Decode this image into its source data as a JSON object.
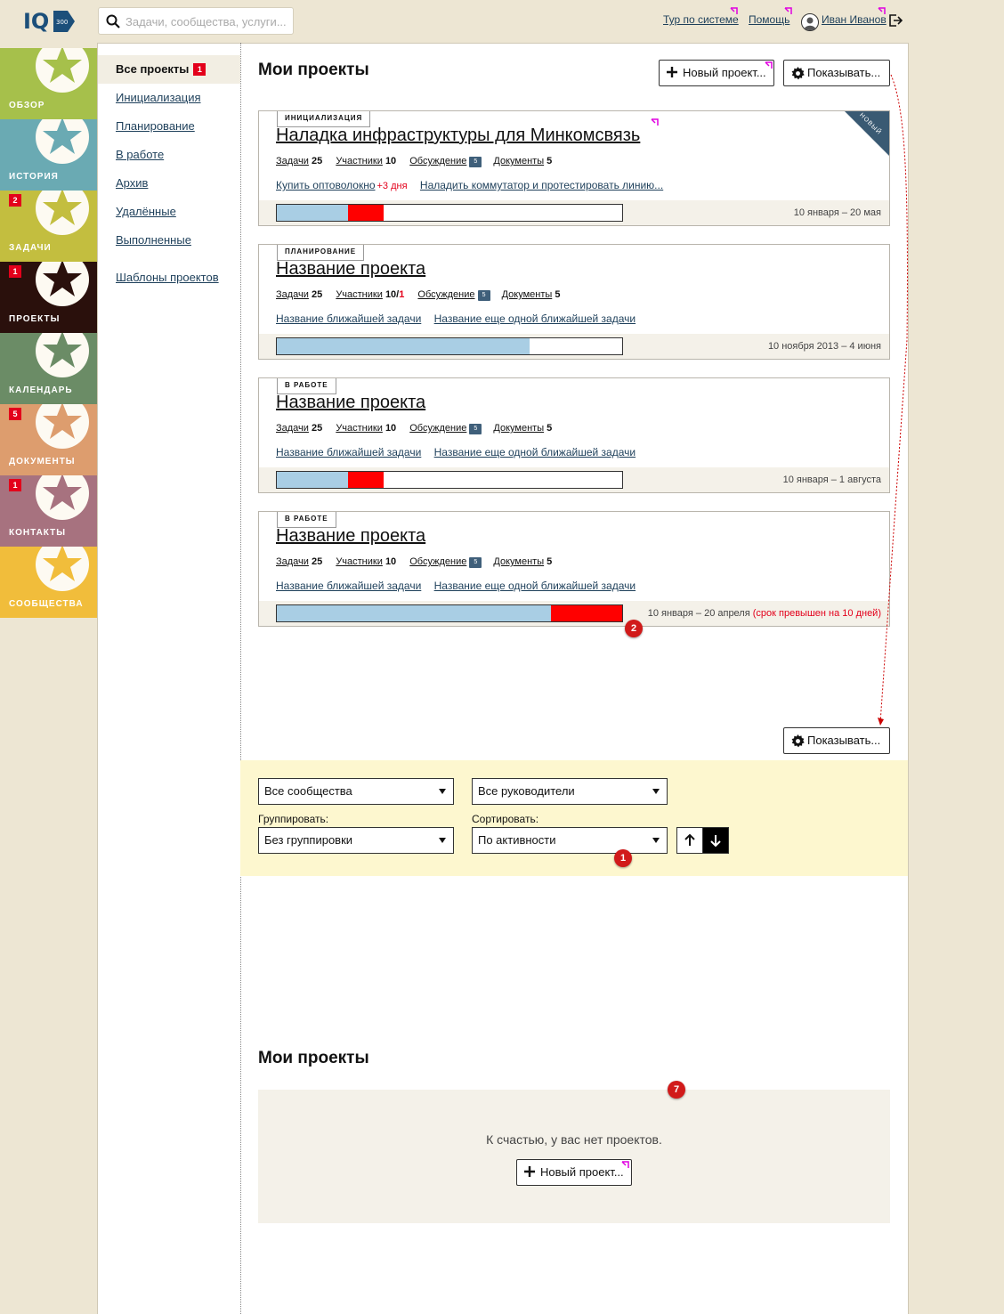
{
  "header": {
    "logo_text": "IQ",
    "logo_sub": "300",
    "search_placeholder": "Задачи, сообщества, услуги...",
    "tour": "Тур по системе",
    "help": "Помощь",
    "user": "Иван Иванов"
  },
  "nav": [
    {
      "label": "ОБЗОР",
      "color": "#a6c04b",
      "star": "#a6c04b",
      "badge": ""
    },
    {
      "label": "ИСТОРИЯ",
      "color": "#6aaab3",
      "star": "#6aaab3",
      "badge": ""
    },
    {
      "label": "ЗАДАЧИ",
      "color": "#c3be3f",
      "star": "#c3be3f",
      "badge": "2"
    },
    {
      "label": "ПРОЕКТЫ",
      "color": "#2a100c",
      "star": "#2a100c",
      "badge": "1"
    },
    {
      "label": "КАЛЕНДАРЬ",
      "color": "#6b8c66",
      "star": "#6b8c66",
      "badge": ""
    },
    {
      "label": "ДОКУМЕНТЫ",
      "color": "#dd9d6e",
      "star": "#dd9d6e",
      "badge": "5"
    },
    {
      "label": "КОНТАКТЫ",
      "color": "#a7727f",
      "star": "#a7727f",
      "badge": "1"
    },
    {
      "label": "СООБЩЕСТВА",
      "color": "#f1bd3b",
      "star": "#f1bd3b",
      "badge": ""
    }
  ],
  "subnav": {
    "all": "Все проекты",
    "all_badge": "1",
    "init": "Инициализация",
    "plan": "Планирование",
    "work": "В работе",
    "archive": "Архив",
    "deleted": "Удалённые",
    "completed": "Выполненные",
    "templates": "Шаблоны проектов"
  },
  "main": {
    "title": "Мои проекты",
    "new_project": "Новый проект...",
    "show": "Показывать..."
  },
  "labels": {
    "tasks": "Задачи",
    "members": "Участники",
    "discussion": "Обсуждение",
    "docs": "Документы",
    "new_corner": "НОВЫЙ"
  },
  "projects": [
    {
      "status": "ИНИЦИАЛИЗАЦИЯ",
      "title": "Наладка инфраструктуры для Минкомсвязь",
      "tasks": "25",
      "members": "10",
      "members_extra": "",
      "discussion": "5",
      "docs": "5",
      "task1": "Купить оптоволокно",
      "task1_late": "+3 дня",
      "task2": "Наладить коммутатор и протестировать линию...",
      "progress_done": 0.205,
      "progress_over": 0.103,
      "dates": "10 января – 20 мая",
      "dates_warn": "",
      "is_new": true
    },
    {
      "status": "ПЛАНИРОВАНИЕ",
      "title": "Название проекта",
      "tasks": "25",
      "members": "10/",
      "members_extra": "1",
      "discussion": "5",
      "docs": "5",
      "task1": "Название ближайшей задачи",
      "task1_late": "",
      "task2": "Название еще одной ближайшей задачи",
      "progress_done": 0.733,
      "progress_over": 0,
      "dates": "10 ноября 2013 – 4 июня",
      "dates_warn": "",
      "is_new": false
    },
    {
      "status": "В РАБОТЕ",
      "title": "Название проекта",
      "tasks": "25",
      "members": "10",
      "members_extra": "",
      "discussion": "5",
      "docs": "5",
      "task1": "Название ближайшей задачи",
      "task1_late": "",
      "task2": "Название еще одной ближайшей задачи",
      "progress_done": 0.205,
      "progress_over": 0.103,
      "dates": "10 января – 1 августа",
      "dates_warn": "",
      "is_new": false
    },
    {
      "status": "В РАБОТЕ",
      "title": "Название проекта",
      "tasks": "25",
      "members": "10",
      "members_extra": "",
      "discussion": "5",
      "docs": "5",
      "task1": "Название ближайшей задачи",
      "task1_late": "",
      "task2": "Название еще одной ближайшей задачи",
      "progress_done": 0.795,
      "progress_over": 0.205,
      "dates": "10 января – 20 апреля ",
      "dates_warn": "(срок превышен на 10 дней)",
      "is_new": false
    }
  ],
  "filter": {
    "communities": "Все сообщества",
    "managers": "Все руководители",
    "group_label": "Группировать:",
    "group_value": "Без группировки",
    "sort_label": "Сортировать:",
    "sort_value": "По активности"
  },
  "markers": {
    "m1": "1",
    "m2": "2",
    "m7": "7"
  },
  "empty": {
    "title": "Мои проекты",
    "message": "К счастью, у вас нет проектов.",
    "new_project": "Новый проект..."
  }
}
